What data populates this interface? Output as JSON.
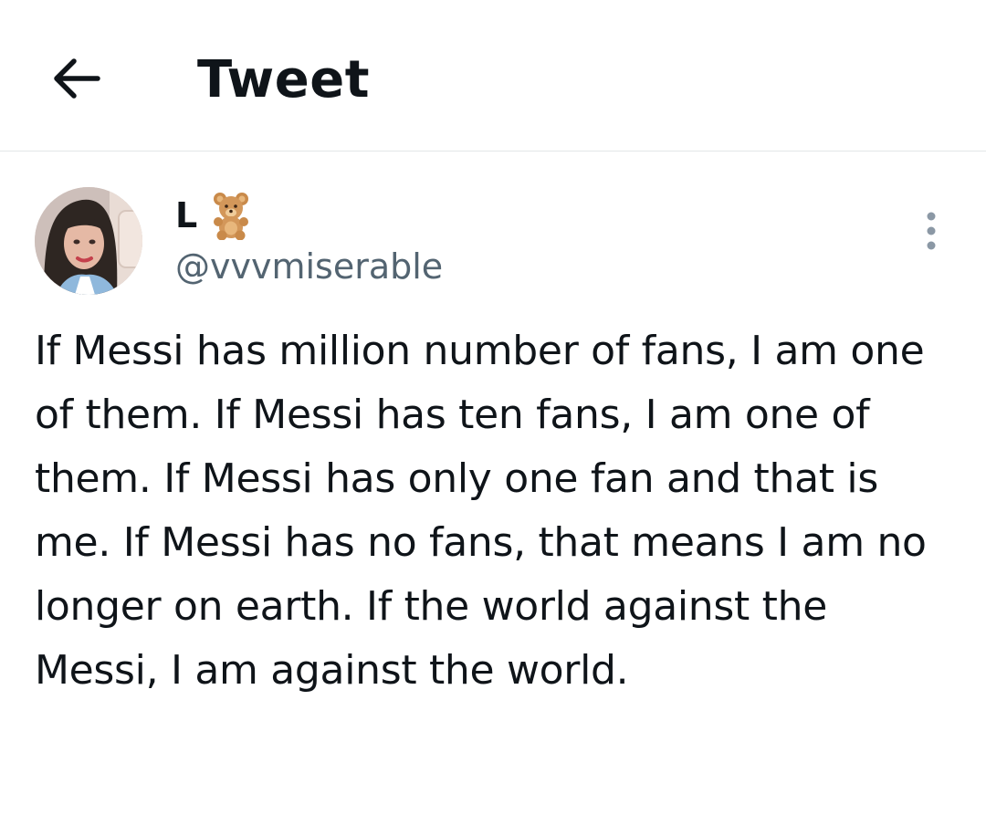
{
  "header": {
    "title": "Tweet",
    "back_icon": "arrow-left-icon"
  },
  "tweet": {
    "author": {
      "display_name": "L",
      "emoji_icon": "teddy-bear-icon",
      "handle": "@vvvmiserable"
    },
    "more_icon": "vertical-ellipsis-icon",
    "text": "If Messi has million number of fans, I am one of them. If Messi has ten fans, I am one of them. If Messi has only one fan and that is me. If Messi has no fans, that means I am no longer on earth. If the world against the Messi, I am against the world."
  },
  "colors": {
    "text_primary": "#0f1419",
    "text_secondary": "#536471",
    "divider": "#e3e6e8",
    "background": "#ffffff"
  }
}
